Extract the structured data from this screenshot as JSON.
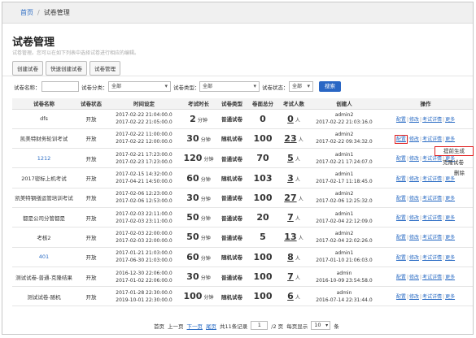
{
  "breadcrumb": {
    "home": "首页",
    "sep": "/",
    "current": "试卷管理"
  },
  "page_title": "试卷管理",
  "description": "试卷管理。您可以在如下列表中选择试卷进行相应的编辑。",
  "toolbar": [
    "创建试卷",
    "快速创建试卷",
    "试卷管理"
  ],
  "filters": {
    "name_label": "试卷名称：",
    "name_value": "",
    "category_label": "试卷分类：",
    "category_value": "全部",
    "type_label": "试卷类型：",
    "type_value": "全部",
    "status_label": "试卷状态：",
    "status_value": "全部",
    "search_label": "搜索"
  },
  "table": {
    "headers": [
      "试卷名称",
      "试卷状态",
      "时间设定",
      "考试时长",
      "试卷类型",
      "卷面总分",
      "考试人数",
      "创建人",
      "操作"
    ],
    "rows": [
      {
        "name": "dfs",
        "status": "开放",
        "start": "2017-02-22 21:04:00.0",
        "end": "2017-02-22 21:05:00.0",
        "duration": "2",
        "duration_unit": "分钟",
        "type": "普通试卷",
        "score": "0",
        "count": "0",
        "count_unit": "人",
        "creator": "admin2",
        "created": "2017-02-22 21:03:16.0"
      },
      {
        "name": "凯美特财务轮训考试",
        "status": "开放",
        "start": "2017-02-22 11:00:00.0",
        "end": "2017-02-22 12:00:00.0",
        "duration": "30",
        "duration_unit": "分钟",
        "type": "随机试卷",
        "score": "100",
        "count": "23",
        "count_unit": "人",
        "creator": "admin2",
        "created": "2017-02-22 09:34:32.0"
      },
      {
        "name": "1212",
        "status": "开放",
        "start": "2017-02-21 17:23:00.0",
        "end": "2017-02-23 17:23:00.0",
        "duration": "120",
        "duration_unit": "分钟",
        "type": "普通试卷",
        "score": "70",
        "count": "5",
        "count_unit": "人",
        "creator": "admin1",
        "created": "2017-02-21 17:24:07.0"
      },
      {
        "name": "2017密标上机考试",
        "status": "开放",
        "start": "2017-02-15 14:32:00.0",
        "end": "2017-04-21 14:50:00.0",
        "duration": "60",
        "duration_unit": "分钟",
        "type": "随机试卷",
        "score": "103",
        "count": "3",
        "count_unit": "人",
        "creator": "admin1",
        "created": "2017-02-17 11:18:45.0"
      },
      {
        "name": "凯美特钢缮运管培训考试",
        "status": "开放",
        "start": "2017-02-06 12:23:00.0",
        "end": "2017-02-06 12:53:00.0",
        "duration": "30",
        "duration_unit": "分钟",
        "type": "普通试卷",
        "score": "100",
        "count": "27",
        "count_unit": "人",
        "creator": "admin2",
        "created": "2017-02-06 12:25:32.0"
      },
      {
        "name": "都是公司分管都是",
        "status": "开放",
        "start": "2017-02-03 22:11:00.0",
        "end": "2017-02-03 23:11:00.0",
        "duration": "50",
        "duration_unit": "分钟",
        "type": "普通试卷",
        "score": "20",
        "count": "7",
        "count_unit": "人",
        "creator": "admin1",
        "created": "2017-02-04 22:12:09.0"
      },
      {
        "name": "考核2",
        "status": "开放",
        "start": "2017-02-03 22:00:00.0",
        "end": "2017-02-03 22:00:00.0",
        "duration": "50",
        "duration_unit": "分钟",
        "type": "普通试卷",
        "score": "5",
        "count": "13",
        "count_unit": "人",
        "creator": "admin2",
        "created": "2017-02-04 22:02:26.0"
      },
      {
        "name": "401",
        "status": "开放",
        "start": "2017-01-21 21:03:00.0",
        "end": "2017-06-30 21:03:00.0",
        "duration": "60",
        "duration_unit": "分钟",
        "type": "随机试卷",
        "score": "100",
        "count": "8",
        "count_unit": "人",
        "creator": "admin1",
        "created": "2017-01-10 21:06:03.0"
      },
      {
        "name": "测试试卷-普通-克隆结果",
        "status": "开放",
        "start": "2016-12-30 22:06:00.0",
        "end": "2017-01-02 22:06:00.0",
        "duration": "30",
        "duration_unit": "分钟",
        "type": "普通试卷",
        "score": "100",
        "count": "7",
        "count_unit": "人",
        "creator": "admin",
        "created": "2016-10-09 23:54:58.0"
      },
      {
        "name": "测试试卷-随机",
        "status": "开放",
        "start": "2017-01-28 22:30:00.0",
        "end": "2019-10-01 22:30:00.0",
        "duration": "100",
        "duration_unit": "分钟",
        "type": "随机试卷",
        "score": "100",
        "count": "6",
        "count_unit": "人",
        "creator": "admin",
        "created": "2016-07-14 22:31:44.0"
      }
    ],
    "ops": {
      "config": "配置",
      "edit": "修改",
      "detail": "考试详情",
      "more": "更多"
    }
  },
  "popup": {
    "first": "提前生成",
    "second": "克隆试卷",
    "third": "删除"
  },
  "pager": {
    "first": "首页",
    "prev": "上一页",
    "next": "下一页",
    "last": "尾页",
    "total": "共11条记录",
    "page": "1",
    "pages": "/2 页",
    "per_page_label": "每页显示",
    "per_page": "10",
    "per_page_unit": "条"
  },
  "colors": {
    "link": "#2b6cc4",
    "button": "#2966c4",
    "highlight": "#e02020"
  }
}
